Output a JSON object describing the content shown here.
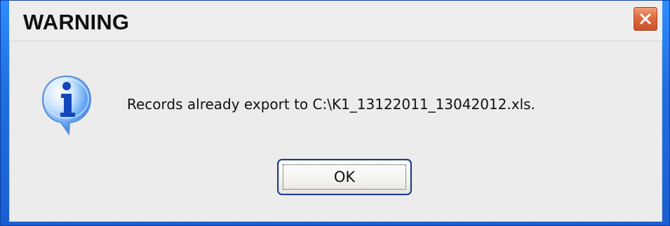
{
  "window": {
    "title": "WARNING"
  },
  "message": {
    "text": "Records already export to C:\\K1_13122011_13042012.xls.",
    "icon": "info-icon"
  },
  "buttons": {
    "ok_label": "OK"
  },
  "icons": {
    "close": "close-icon",
    "info": "info-icon"
  },
  "colors": {
    "title_bar_background": "#ededed",
    "dialog_background": "#ececec",
    "close_button": "#df6a3e",
    "window_frame": "#1f6fe0",
    "ok_border": "#1b3f8e",
    "info_icon": "#2f7be7"
  }
}
